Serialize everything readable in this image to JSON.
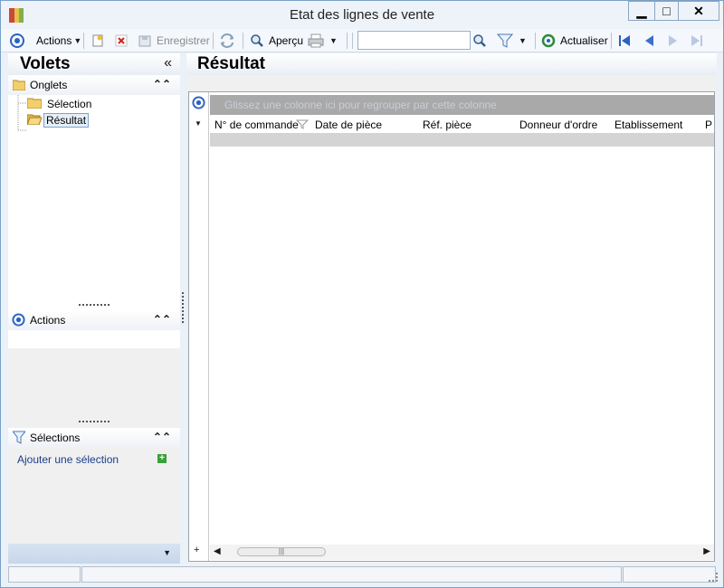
{
  "window": {
    "title": "Etat des lignes de vente",
    "minimize": "▁",
    "maximize": "□",
    "close": "✕"
  },
  "toolbar": {
    "actions_label": "Actions",
    "save_label": "Enregistrer",
    "preview_label": "Aperçu",
    "refresh_label": "Actualiser",
    "search_value": ""
  },
  "left_panel": {
    "title": "Volets",
    "collapse_glyph": "«",
    "tabs_section": {
      "title": "Onglets",
      "items": [
        {
          "label": "Sélection",
          "selected": false
        },
        {
          "label": "Résultat",
          "selected": true
        }
      ]
    },
    "actions_section": {
      "title": "Actions"
    },
    "selections_section": {
      "title": "Sélections",
      "add_link": "Ajouter une sélection"
    }
  },
  "main": {
    "title": "Résultat",
    "group_hint": "Glissez une colonne ici pour regrouper par cette colonne",
    "columns": [
      "N° de commande",
      "Date de pièce",
      "Réf. pièce",
      "Donneur d'ordre",
      "Etablissement",
      "P"
    ]
  },
  "colors": {
    "accent": "#2a62c2",
    "header_gradient_end": "#e9eef5",
    "group_bar": "#a9a9a9"
  },
  "icons": [
    "app-icon",
    "options-icon",
    "new-icon",
    "delete-icon",
    "save-icon",
    "sync-icon",
    "magnifier-icon",
    "print-icon",
    "search-icon",
    "filter-icon",
    "refresh-icon",
    "first-icon",
    "previous-icon",
    "next-icon",
    "last-icon",
    "folder-icon",
    "open-folder-icon",
    "funnel-icon",
    "plus-icon"
  ]
}
